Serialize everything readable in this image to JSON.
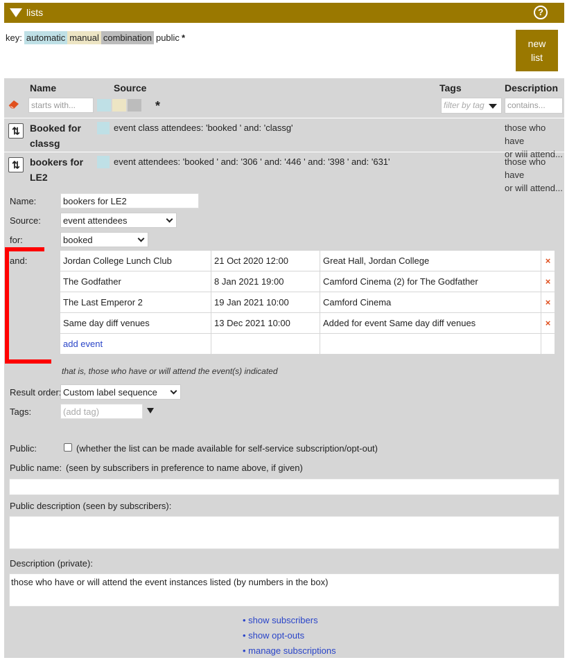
{
  "header": {
    "title": "lists",
    "help_icon": "help-circle-icon"
  },
  "key": {
    "label": "key:",
    "automatic": "automatic",
    "manual": "manual",
    "combination": "combination",
    "public": "public",
    "public_star": "*"
  },
  "new_list_button": {
    "line1": "new",
    "line2": "list"
  },
  "columns": {
    "name": "Name",
    "source": "Source",
    "tags": "Tags",
    "description": "Description"
  },
  "filters": {
    "name_placeholder": "starts with...",
    "star": "*",
    "tags_placeholder": "filter by tag",
    "description_placeholder": "contains..."
  },
  "lists": [
    {
      "name_line1": "Booked for",
      "name_line2": "classg",
      "source": "event class attendees: 'booked ' and: 'classg'",
      "desc_line1": "those who have",
      "desc_line2": "or will attend..."
    },
    {
      "name_line1": "bookers for",
      "name_line2": "LE2",
      "source": "event attendees: 'booked ' and: '306 ' and: '446 ' and: '398 ' and: '631'",
      "desc_line1": "those who have",
      "desc_line2": "or will attend..."
    }
  ],
  "form": {
    "name_label": "Name:",
    "name_value": "bookers for LE2",
    "source_label": "Source:",
    "source_value": "event attendees",
    "for_label": "for:",
    "for_value": "booked",
    "and_label": "and:",
    "events": [
      {
        "title": "Jordan College Lunch Club",
        "date": "21 Oct 2020 12:00",
        "venue": "Great Hall, Jordan College"
      },
      {
        "title": "The Godfather",
        "date": "8 Jan 2021 19:00",
        "venue": "Camford Cinema (2) for The Godfather"
      },
      {
        "title": "The Last Emperor 2",
        "date": "19 Jan 2021 10:00",
        "venue": "Camford Cinema"
      },
      {
        "title": "Same day diff venues",
        "date": "13 Dec 2021 10:00",
        "venue": "Added for event Same day diff venues"
      }
    ],
    "remove_glyph": "×",
    "add_event": "add event",
    "note": "that is, those who have or will attend the event(s) indicated",
    "result_order_label": "Result order:",
    "result_order_value": "Custom label sequence",
    "tags_label": "Tags:",
    "tags_placeholder": "(add tag)",
    "public_label": "Public:",
    "public_hint": "(whether the list can be made available for self-service subscription/opt-out)",
    "public_name_label": "Public name:",
    "public_name_hint": "(seen by subscribers in preference to name above, if given)",
    "public_desc_label": "Public description (seen by subscribers):",
    "private_desc_label": "Description (private):",
    "private_desc_value": "those who have or will attend the event instances listed (by numbers in the box)"
  },
  "links": {
    "show_subscribers": "• show subscribers",
    "show_optouts": "• show opt-outs",
    "manage": "• manage subscriptions"
  },
  "colors": {
    "brand": "#9a7800",
    "automatic": "#bfe0e6",
    "manual": "#ede5c4",
    "combination": "#bcbcbc",
    "remove": "#e0501e",
    "link": "#2a45c8",
    "annotation": "#ff0000"
  }
}
